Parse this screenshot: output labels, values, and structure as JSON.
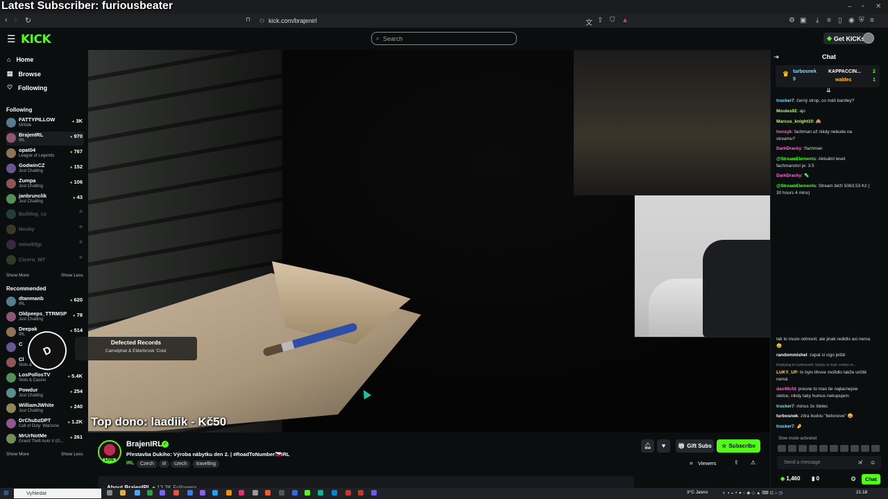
{
  "overlay": {
    "latest_subscriber": "Latest Subscriber: furiousbeater"
  },
  "browser": {
    "url": "kick.com/brajenirl"
  },
  "header": {
    "logo": "KICK",
    "search_placeholder": "Search",
    "get_kicks": "Get KICKs"
  },
  "nav": [
    {
      "label": "Home",
      "icon": "home-icon"
    },
    {
      "label": "Browse",
      "icon": "browse-icon"
    },
    {
      "label": "Following",
      "icon": "heart-icon"
    }
  ],
  "following": {
    "title": "Following",
    "channels": [
      {
        "name": "FATTYPILLOW",
        "category": "MiSide",
        "viewers": "3K",
        "online": true
      },
      {
        "name": "BrajenIRL",
        "category": "IRL",
        "viewers": "970",
        "online": true
      },
      {
        "name": "opat04",
        "category": "League of Legends",
        "viewers": "767",
        "online": true
      },
      {
        "name": "GodwinCZ",
        "category": "Just Chatting",
        "viewers": "152",
        "online": true
      },
      {
        "name": "Zumpa",
        "category": "Just Chatting",
        "viewers": "106",
        "online": true
      },
      {
        "name": "janbrunclik",
        "category": "Just Chatting",
        "viewers": "43",
        "online": true
      },
      {
        "name": "Bulldog_cz",
        "category": "",
        "viewers": "",
        "online": false
      },
      {
        "name": "Novby",
        "category": "",
        "viewers": "",
        "online": false
      },
      {
        "name": "mino55jp",
        "category": "",
        "viewers": "",
        "online": false
      },
      {
        "name": "Cicero_MT",
        "category": "",
        "viewers": "",
        "online": false
      }
    ],
    "show_more": "Show More",
    "show_less": "Show Less"
  },
  "recommended": {
    "title": "Recommended",
    "channels": [
      {
        "name": "dtanmanb",
        "category": "IRL",
        "viewers": "620"
      },
      {
        "name": "Oldpeeps_TTRMSP",
        "category": "Just Chatting",
        "viewers": "78"
      },
      {
        "name": "Deepak",
        "category": "IRL",
        "viewers": "514"
      },
      {
        "name": "C",
        "category": "",
        "viewers": ""
      },
      {
        "name": "Cl",
        "category": "Slots &",
        "viewers": ""
      },
      {
        "name": "LosPollosTV",
        "category": "Slots & Casino",
        "viewers": "5.4K"
      },
      {
        "name": "Powdur",
        "category": "Just Chatting",
        "viewers": "254"
      },
      {
        "name": "WilliamJWhite",
        "category": "Just Chatting",
        "viewers": "240"
      },
      {
        "name": "DrChubzDPT",
        "category": "Call of Duty: Warzone",
        "viewers": "1.2K"
      },
      {
        "name": "MrUrNotMe",
        "category": "Grand Theft Auto V (G...",
        "viewers": "261"
      }
    ],
    "show_more": "Show More",
    "show_less": "Show Less"
  },
  "video": {
    "top_dono": "Top dono: laadiik - Kč50",
    "now_playing_title": "Defected Records",
    "now_playing_artist": "Camelphat & Elderbrook 'Cola'"
  },
  "stream": {
    "streamer": "BrajenIRL",
    "live_badge": "LIVE",
    "title": "Přestavba Dukiho: Výroba nábytku den 2. | #RoadToNumber🇨🇿IRL",
    "category": "IRL",
    "tags": [
      "Czech",
      "irl",
      "czech",
      "travelling"
    ],
    "gift_subs": "Gift Subs",
    "subscribe": "Subscribe",
    "viewers_label": "Viewers",
    "about": "About BrajenIRL",
    "followers": "13.3K Followers"
  },
  "chat": {
    "title": "Chat",
    "pinned": [
      {
        "user": "turbosnek",
        "value": "5"
      },
      {
        "user": "KAPPACCIN...",
        "value": "2"
      },
      {
        "user": "waldes",
        "value": "1"
      }
    ],
    "messages": [
      {
        "user": "trucker7",
        "color": "#7ee0ff",
        "text": ": černý strop, co máš bantley?"
      },
      {
        "user": "Moules92",
        "color": "#b6ff5a",
        "text": ": ajo"
      },
      {
        "user": "Marcus_knight10",
        "color": "#b6ff5a",
        "text": ": 🙈"
      },
      {
        "user": "honzyk",
        "color": "#ff6ad5",
        "text": ": fachman už nikdy nebude na streamu?"
      },
      {
        "user": "DarkDracky",
        "color": "#ff6ad5",
        "text": ": !fachman"
      },
      {
        "user": "@StreamElements",
        "color": "#53fc18",
        "text": ": Aktuální level fachmanství je: 3.5"
      },
      {
        "user": "DarkDracky",
        "color": "#ff6ad5",
        "text": ": 🦠"
      },
      {
        "user": "@StreamElements",
        "color": "#53fc18",
        "text": ": Stream běží 5063.53 Kč ( 30 hours 4 mins)"
      },
      {
        "user": "",
        "color": "#ddd",
        "text": "tak to muze odmocit, ale jinak redidlo asi nema 😀"
      },
      {
        "user": "randommishel",
        "color": "#ffffff",
        "text": ": zapal si cigo ještě"
      },
      {
        "user": "LUKY_UP",
        "color": "#ffd84a",
        "text": ": to bylo lihove mořidlo takže určitě nemá"
      },
      {
        "user": "dax40cfd",
        "color": "#ff6ad5",
        "text": ": presne to mas tie najlacnejsie stetce, nikdy taky humus nekupujem"
      },
      {
        "user": "trucker7",
        "color": "#7ee0ff",
        "text": ": minus 3x štetec"
      },
      {
        "user": "turbosnek",
        "color": "#ffffff",
        "text": ": zítra budou \"betonove\" 😀"
      },
      {
        "user": "trucker7",
        "color": "#7ee0ff",
        "text": ": 🤌"
      }
    ],
    "reply_context": "Replying to turbosnek: kdyby to bylo vodou re...",
    "slow_mode": "Slow mode activated",
    "input_placeholder": "Send a message",
    "kicks": "1,460",
    "other_count": "0",
    "send_label": "Chat"
  },
  "taskbar": {
    "search": "Vyhledat",
    "weather": "3°C  Jasno",
    "time": "21:18"
  },
  "colors": {
    "accent": "#53fc18",
    "bg": "#0b0e0f",
    "panel": "#24272c"
  }
}
